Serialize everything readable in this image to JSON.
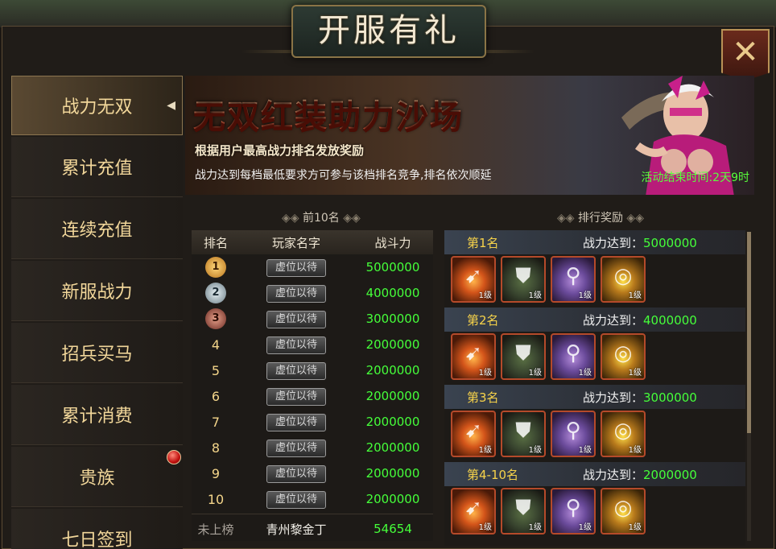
{
  "window": {
    "title": "开服有礼",
    "close_icon": "close-x-icon"
  },
  "sidebar": {
    "items": [
      {
        "label": "战力无双",
        "active": true
      },
      {
        "label": "累计充值"
      },
      {
        "label": "连续充值"
      },
      {
        "label": "新服战力"
      },
      {
        "label": "招兵买马"
      },
      {
        "label": "累计消费"
      },
      {
        "label": "贵族",
        "badge": true
      },
      {
        "label": "七日签到"
      }
    ]
  },
  "banner": {
    "title": "无双红装助力沙场",
    "subtitle": "根据用户最高战力排名发放奖励",
    "rule": "战力达到每档最低要求方可参与该档排名竞争,排名依次顺延",
    "end_time": "活动结束时间:2天9时"
  },
  "leaderboard": {
    "section_title": "前10名",
    "headers": {
      "rank": "排名",
      "player": "玩家名字",
      "power": "战斗力"
    },
    "rows": [
      {
        "rank": "1",
        "player": "虚位以待",
        "power": "5000000"
      },
      {
        "rank": "2",
        "player": "虚位以待",
        "power": "4000000"
      },
      {
        "rank": "3",
        "player": "虚位以待",
        "power": "3000000"
      },
      {
        "rank": "4",
        "player": "虚位以待",
        "power": "2000000"
      },
      {
        "rank": "5",
        "player": "虚位以待",
        "power": "2000000"
      },
      {
        "rank": "6",
        "player": "虚位以待",
        "power": "2000000"
      },
      {
        "rank": "7",
        "player": "虚位以待",
        "power": "2000000"
      },
      {
        "rank": "8",
        "player": "虚位以待",
        "power": "2000000"
      },
      {
        "rank": "9",
        "player": "虚位以待",
        "power": "2000000"
      },
      {
        "rank": "10",
        "player": "虚位以待",
        "power": "2000000"
      }
    ],
    "self": {
      "rank": "未上榜",
      "player": "青州黎金丁",
      "power": "54654"
    }
  },
  "rewards": {
    "section_title": "排行奖励",
    "req_label": "战力达到：",
    "tiers": [
      {
        "name": "第1名",
        "req": "5000000"
      },
      {
        "name": "第2名",
        "req": "4000000"
      },
      {
        "name": "第3名",
        "req": "3000000"
      },
      {
        "name": "第4-10名",
        "req": "2000000"
      }
    ],
    "items": [
      {
        "icon": "crossbow-icon",
        "level": "1级"
      },
      {
        "icon": "armor-icon",
        "level": "1级"
      },
      {
        "icon": "boots-icon",
        "level": "1级"
      },
      {
        "icon": "necklace-icon",
        "level": "1级"
      }
    ]
  },
  "colors": {
    "accent_gold": "#f2d79a",
    "power_green": "#45ff3a",
    "time_green": "#58ff3c",
    "tier_yellow": "#f6d24a"
  }
}
